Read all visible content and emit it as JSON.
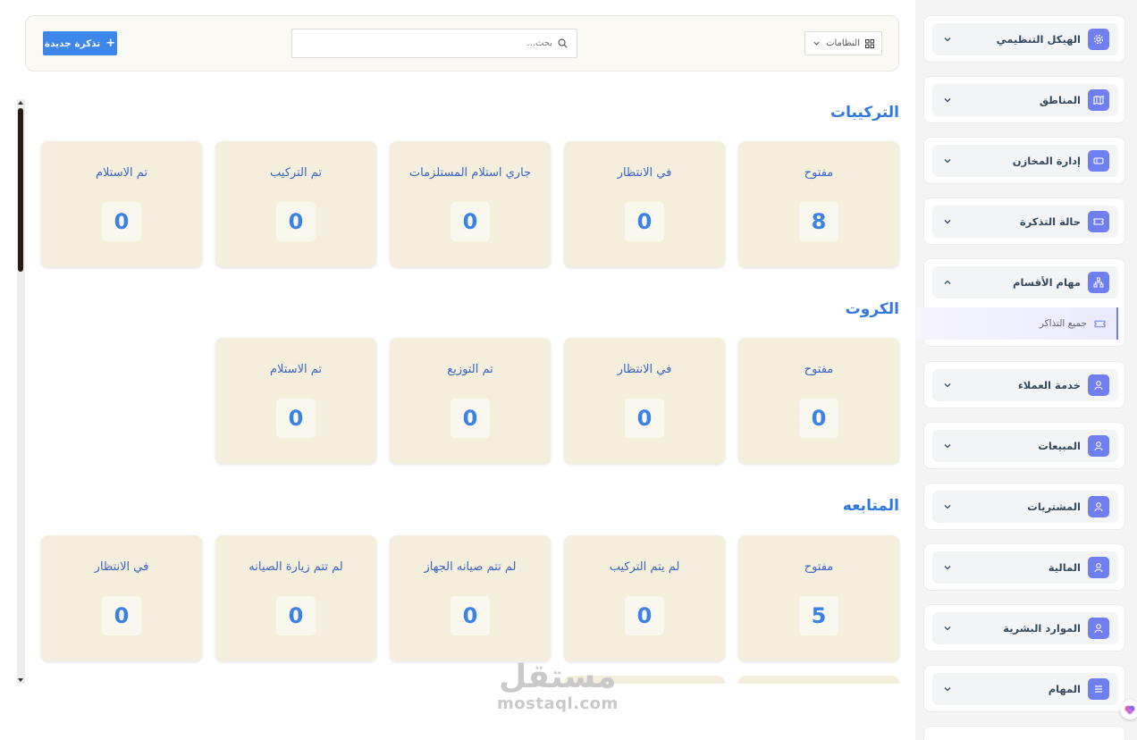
{
  "header": {
    "new_ticket_label": "تذكرة جديدة",
    "search_placeholder": "بحث...",
    "filter_label": "النظامات"
  },
  "sections": [
    {
      "title": "التركيبات",
      "cards": [
        {
          "label": "مفتوح",
          "value": "8"
        },
        {
          "label": "في الانتظار",
          "value": "0"
        },
        {
          "label": "جاري استلام المستلزمات",
          "value": "0"
        },
        {
          "label": "تم التركيب",
          "value": "0"
        },
        {
          "label": "تم الاستلام",
          "value": "0"
        }
      ]
    },
    {
      "title": "الكروت",
      "cards": [
        {
          "label": "مفتوح",
          "value": "0"
        },
        {
          "label": "في الانتظار",
          "value": "0"
        },
        {
          "label": "تم التوزيع",
          "value": "0"
        },
        {
          "label": "تم الاستلام",
          "value": "0"
        }
      ]
    },
    {
      "title": "المتابعه",
      "cards": [
        {
          "label": "مفتوح",
          "value": "5"
        },
        {
          "label": "لم يتم التركيب",
          "value": "0"
        },
        {
          "label": "لم تتم صيانه الجهاز",
          "value": "0"
        },
        {
          "label": "لم تتم زيارة الصيانه",
          "value": "0"
        },
        {
          "label": "في الانتظار",
          "value": "0"
        }
      ]
    }
  ],
  "sidebar": {
    "items": [
      {
        "label": "الهيكل التنظيمي",
        "icon": "gear-icon"
      },
      {
        "label": "المناطق",
        "icon": "map-icon"
      },
      {
        "label": "إدارة المخازن",
        "icon": "warehouse-icon"
      },
      {
        "label": "حالة التذكرة",
        "icon": "ticket-icon"
      },
      {
        "label": "مهام الأقسام",
        "icon": "sitemap-icon",
        "sub": "جميع التذاكر"
      },
      {
        "label": "خدمة العملاء",
        "icon": "user-icon"
      },
      {
        "label": "المبيعات",
        "icon": "user-icon"
      },
      {
        "label": "المشتريات",
        "icon": "user-icon"
      },
      {
        "label": "المالية",
        "icon": "user-icon"
      },
      {
        "label": "الموارد البشرية",
        "icon": "user-icon"
      },
      {
        "label": "المهام",
        "icon": "list-icon"
      }
    ]
  },
  "watermark": {
    "arabic": "مستقل",
    "latin": "mostaql.com"
  },
  "colors": {
    "accent": "#3d86ea",
    "card_bg": "#f4eedd",
    "title": "#2f78e0",
    "sidebar_icon": "#6f7ff0"
  }
}
